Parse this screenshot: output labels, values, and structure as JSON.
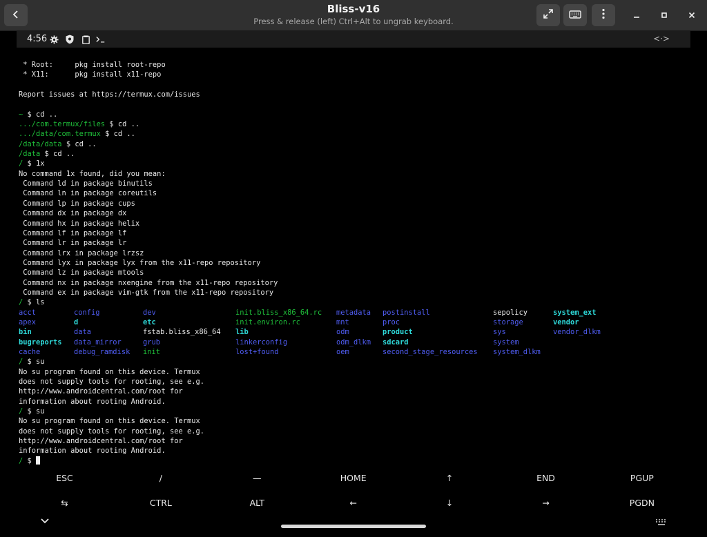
{
  "window": {
    "title": "Bliss-v16",
    "subtitle": "Press & release (left) Ctrl+Alt to ungrab keyboard."
  },
  "icons": {
    "back": "chevron-left-icon",
    "fullscreen": "fullscreen-icon",
    "keyboard": "keyboard-icon",
    "menu": "vertical-dots-icon",
    "minimize": "minimize-icon",
    "maximize": "maximize-icon",
    "close": "close-icon"
  },
  "status_bar": {
    "time": "4:56",
    "right_glyph": "<·>"
  },
  "terminal": {
    "lines_top": [
      {
        "parts": [
          {
            "t": " * Root:     pkg install root-repo",
            "c": ""
          }
        ]
      },
      {
        "parts": [
          {
            "t": " * X11:      pkg install x11-repo",
            "c": ""
          }
        ]
      },
      {
        "parts": [
          {
            "t": "",
            "c": ""
          }
        ]
      },
      {
        "parts": [
          {
            "t": "Report issues at https://termux.com/issues",
            "c": ""
          }
        ]
      },
      {
        "parts": [
          {
            "t": "",
            "c": ""
          }
        ]
      },
      {
        "parts": [
          {
            "t": "~ ",
            "c": "g"
          },
          {
            "t": "$ cd ..",
            "c": ""
          }
        ]
      },
      {
        "parts": [
          {
            "t": ".../com.termux/files ",
            "c": "g"
          },
          {
            "t": "$ cd ..",
            "c": ""
          }
        ]
      },
      {
        "parts": [
          {
            "t": ".../data/com.termux ",
            "c": "g"
          },
          {
            "t": "$ cd ..",
            "c": ""
          }
        ]
      },
      {
        "parts": [
          {
            "t": "/data/data ",
            "c": "g"
          },
          {
            "t": "$ cd ..",
            "c": ""
          }
        ]
      },
      {
        "parts": [
          {
            "t": "/data ",
            "c": "g"
          },
          {
            "t": "$ cd ..",
            "c": ""
          }
        ]
      },
      {
        "parts": [
          {
            "t": "/ ",
            "c": "g"
          },
          {
            "t": "$ 1x",
            "c": ""
          }
        ]
      },
      {
        "parts": [
          {
            "t": "No command 1x found, did you mean:",
            "c": ""
          }
        ]
      },
      {
        "parts": [
          {
            "t": " Command ld in package binutils",
            "c": ""
          }
        ]
      },
      {
        "parts": [
          {
            "t": " Command ln in package coreutils",
            "c": ""
          }
        ]
      },
      {
        "parts": [
          {
            "t": " Command lp in package cups",
            "c": ""
          }
        ]
      },
      {
        "parts": [
          {
            "t": " Command dx in package dx",
            "c": ""
          }
        ]
      },
      {
        "parts": [
          {
            "t": " Command hx in package helix",
            "c": ""
          }
        ]
      },
      {
        "parts": [
          {
            "t": " Command lf in package lf",
            "c": ""
          }
        ]
      },
      {
        "parts": [
          {
            "t": " Command lr in package lr",
            "c": ""
          }
        ]
      },
      {
        "parts": [
          {
            "t": " Command lrx in package lrzsz",
            "c": ""
          }
        ]
      },
      {
        "parts": [
          {
            "t": " Command lyx in package lyx from the x11-repo repository",
            "c": ""
          }
        ]
      },
      {
        "parts": [
          {
            "t": " Command lz in package mtools",
            "c": ""
          }
        ]
      },
      {
        "parts": [
          {
            "t": " Command nx in package nxengine from the x11-repo repository",
            "c": ""
          }
        ]
      },
      {
        "parts": [
          {
            "t": " Command ex in package vim-gtk from the x11-repo repository",
            "c": ""
          }
        ]
      },
      {
        "parts": [
          {
            "t": "/ ",
            "c": "g"
          },
          {
            "t": "$ ls",
            "c": ""
          }
        ]
      }
    ],
    "ls_columns": [
      [
        {
          "t": "acct",
          "c": "blue"
        },
        {
          "t": "apex",
          "c": "blue"
        },
        {
          "t": "bin",
          "c": "bcyan"
        },
        {
          "t": "bugreports",
          "c": "bcyan"
        },
        {
          "t": "cache",
          "c": "blue"
        }
      ],
      [
        {
          "t": "config",
          "c": "blue"
        },
        {
          "t": "d",
          "c": "bcyan"
        },
        {
          "t": "data",
          "c": "blue"
        },
        {
          "t": "data_mirror",
          "c": "blue"
        },
        {
          "t": "debug_ramdisk",
          "c": "blue"
        }
      ],
      [
        {
          "t": "dev",
          "c": "blue"
        },
        {
          "t": "etc",
          "c": "bcyan"
        },
        {
          "t": "fstab.bliss_x86_64",
          "c": "white"
        },
        {
          "t": "grub",
          "c": "blue"
        },
        {
          "t": "init",
          "c": "g"
        }
      ],
      [
        {
          "t": "init.bliss_x86_64.rc",
          "c": "g"
        },
        {
          "t": "init.environ.rc",
          "c": "g"
        },
        {
          "t": "lib",
          "c": "bcyan"
        },
        {
          "t": "linkerconfig",
          "c": "blue"
        },
        {
          "t": "lost+found",
          "c": "blue"
        }
      ],
      [
        {
          "t": "metadata",
          "c": "blue"
        },
        {
          "t": "mnt",
          "c": "blue"
        },
        {
          "t": "odm",
          "c": "blue"
        },
        {
          "t": "odm_dlkm",
          "c": "blue"
        },
        {
          "t": "oem",
          "c": "blue"
        }
      ],
      [
        {
          "t": "postinstall",
          "c": "blue"
        },
        {
          "t": "proc",
          "c": "blue"
        },
        {
          "t": "product",
          "c": "bcyan"
        },
        {
          "t": "sdcard",
          "c": "bcyan"
        },
        {
          "t": "second_stage_resources",
          "c": "blue"
        }
      ],
      [
        {
          "t": "sepolicy",
          "c": "white"
        },
        {
          "t": "storage",
          "c": "blue"
        },
        {
          "t": "sys",
          "c": "blue"
        },
        {
          "t": "system",
          "c": "blue"
        },
        {
          "t": "system_dlkm",
          "c": "blue"
        }
      ],
      [
        {
          "t": "system_ext",
          "c": "bcyan"
        },
        {
          "t": "vendor",
          "c": "bcyan"
        },
        {
          "t": "vendor_dlkm",
          "c": "blue"
        }
      ]
    ],
    "lines_bottom": [
      {
        "parts": [
          {
            "t": "/ ",
            "c": "g"
          },
          {
            "t": "$ su",
            "c": ""
          }
        ]
      },
      {
        "parts": [
          {
            "t": "No su program found on this device. Termux",
            "c": ""
          }
        ]
      },
      {
        "parts": [
          {
            "t": "does not supply tools for rooting, see e.g.",
            "c": ""
          }
        ]
      },
      {
        "parts": [
          {
            "t": "http://www.androidcentral.com/root for",
            "c": ""
          }
        ]
      },
      {
        "parts": [
          {
            "t": "information about rooting Android.",
            "c": ""
          }
        ]
      },
      {
        "parts": [
          {
            "t": "/ ",
            "c": "g"
          },
          {
            "t": "$ su",
            "c": ""
          }
        ]
      },
      {
        "parts": [
          {
            "t": "No su program found on this device. Termux",
            "c": ""
          }
        ]
      },
      {
        "parts": [
          {
            "t": "does not supply tools for rooting, see e.g.",
            "c": ""
          }
        ]
      },
      {
        "parts": [
          {
            "t": "http://www.androidcentral.com/root for",
            "c": ""
          }
        ]
      },
      {
        "parts": [
          {
            "t": "information about rooting Android.",
            "c": ""
          }
        ]
      }
    ],
    "prompt": {
      "dir": "/ ",
      "sym": "$ "
    }
  },
  "extra_keys": {
    "row1": [
      "ESC",
      "/",
      "—",
      "HOME",
      "↑",
      "END",
      "PGUP"
    ],
    "row2": [
      "⇆",
      "CTRL",
      "ALT",
      "←",
      "↓",
      "→",
      "PGDN"
    ]
  }
}
